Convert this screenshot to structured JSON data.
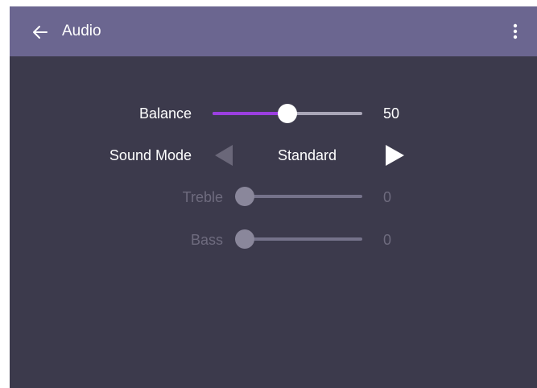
{
  "header": {
    "title": "Audio",
    "back_icon": "arrow-left-icon",
    "menu_icon": "more-vertical-icon"
  },
  "balance": {
    "label": "Balance",
    "value": "50",
    "level": 0.5
  },
  "sound_mode": {
    "label": "Sound Mode",
    "value": "Standard",
    "prev_icon": "triangle-left-icon",
    "next_icon": "triangle-right-icon"
  },
  "treble": {
    "label": "Treble",
    "value": "0",
    "level": 0
  },
  "bass": {
    "label": "Bass",
    "value": "0",
    "level": 0
  },
  "colors": {
    "app_bar": "#6b6690",
    "background": "#3c3a4c",
    "accent": "#9b3fe0",
    "disabled_text": "#6e6b7e"
  }
}
